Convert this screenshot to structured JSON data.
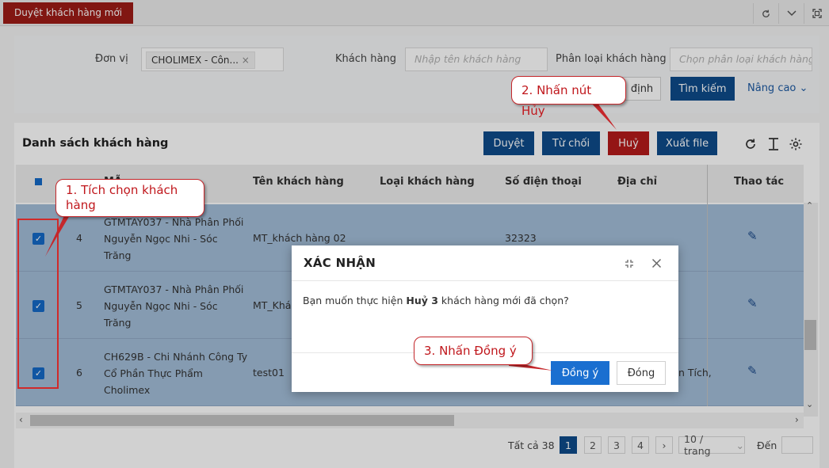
{
  "top_tab": "Duyệt khách hàng mới",
  "filter": {
    "don_vi_label": "Đơn vị",
    "don_vi_value": "CHOLIMEX - Côn...",
    "khach_hang_label": "Khách hàng",
    "khach_hang_placeholder": "Nhập tên khách hàng",
    "phan_loai_label": "Phân loại khách hàng",
    "phan_loai_placeholder": "Chọn phân loại khách hàng",
    "mac_dinh": "định",
    "tim_kiem": "Tìm kiếm",
    "nang_cao": "Nâng cao"
  },
  "list": {
    "title": "Danh sách khách hàng",
    "buttons": {
      "duyet": "Duyệt",
      "tu_choi": "Từ chối",
      "huy": "Huỷ",
      "xuat_file": "Xuất file"
    },
    "columns": {
      "ten": "Tên khách hàng",
      "loai": "Loại khách hàng",
      "sdt": "Số điện thoại",
      "dia_chi": "Địa chỉ",
      "thao_tac": "Thao tác"
    },
    "rows": [
      {
        "stt": "4",
        "ma": [
          "GTMTAY037 - Nhà Phân Phối",
          "Nguyễn Ngọc Nhi - Sóc",
          "Trăng"
        ],
        "ten": "MT_khách hàng 02",
        "sdt": "32323",
        "dia_chi": ""
      },
      {
        "stt": "5",
        "ma": [
          "GTMTAY037 - Nhà Phân Phối",
          "Nguyễn Ngọc Nhi - Sóc",
          "Trăng"
        ],
        "ten": "MT_Khá",
        "sdt": "",
        "dia_chi": ""
      },
      {
        "stt": "6",
        "ma": [
          "CH629B - Chi Nhánh Công Ty",
          "Cổ Phần Thực Phẩm",
          "Cholimex"
        ],
        "ten": "test01",
        "sdt": "",
        "dia_chi": "n Tích,"
      }
    ]
  },
  "pagination": {
    "total": "Tất cả 38",
    "pages": [
      "1",
      "2",
      "3",
      "4"
    ],
    "per_page": "10 / trang",
    "goto": "Đến"
  },
  "modal": {
    "title": "XÁC NHẬN",
    "message_prefix": "Bạn muốn thực hiện",
    "message_bold": "Huỷ 3",
    "message_suffix": "khách hàng mới đã chọn?",
    "confirm": "Đồng ý",
    "close": "Đóng"
  },
  "callouts": {
    "step1": "1. Tích chọn khách hàng",
    "step2": "2. Nhấn nút Hủy",
    "step3": "3. Nhấn Đồng ý"
  },
  "colors": {
    "primary": "#0e4b8a",
    "danger": "#b51a1a",
    "row_selected": "#a3bdd8",
    "callout_red": "#c5272b"
  }
}
